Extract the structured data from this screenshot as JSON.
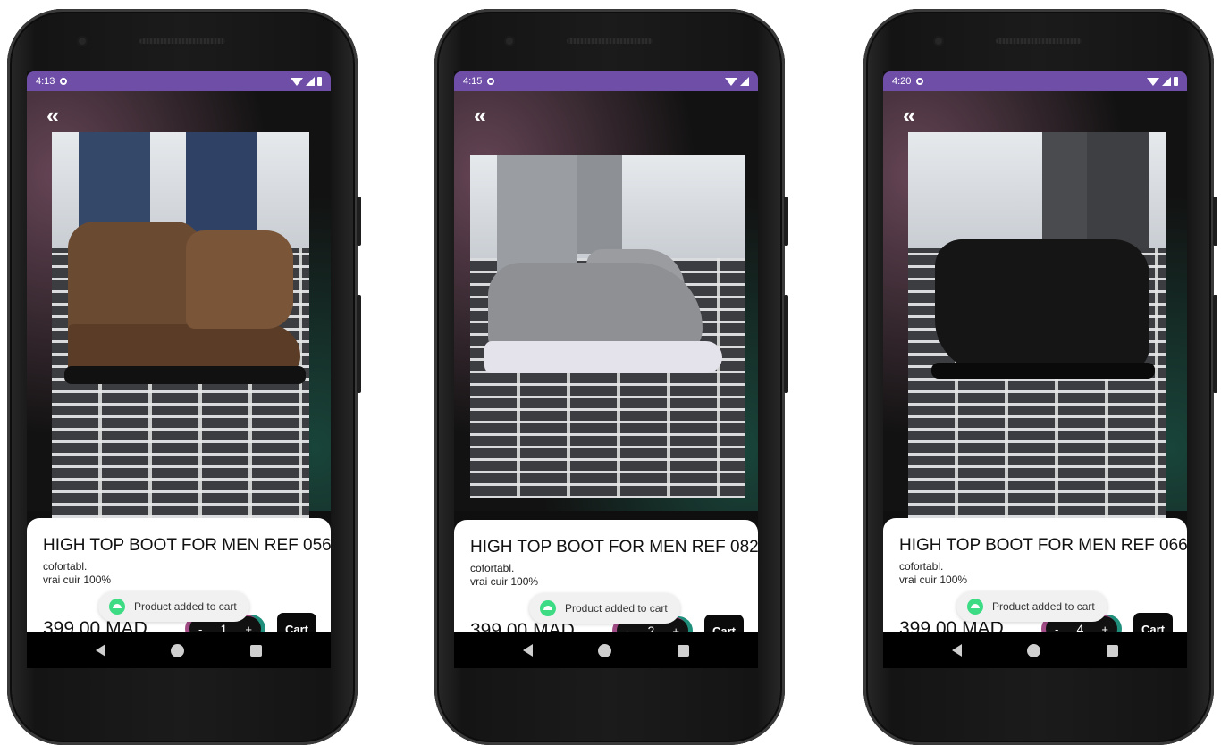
{
  "phones": [
    {
      "status_time": "4:13",
      "product_title": "HIGH TOP BOOT FOR MEN REF 056",
      "description_line1": "cofortabl.",
      "description_line2": "vrai cuir 100%",
      "price": "399.00 MAD",
      "quantity": "1",
      "minus_label": "-",
      "plus_label": "+",
      "cart_label": "Cart",
      "toast_text": "Product added to cart",
      "shoe_color": "#6b4a32",
      "shoe_style": "boot"
    },
    {
      "status_time": "4:15",
      "product_title": "HIGH TOP BOOT FOR MEN REF 082",
      "description_line1": "cofortabl.",
      "description_line2": "vrai cuir 100%",
      "price": "399.00 MAD",
      "quantity": "2",
      "minus_label": "-",
      "plus_label": "+",
      "cart_label": "Cart",
      "toast_text": "Product added to cart",
      "shoe_color": "#8e9093",
      "shoe_style": "sneaker"
    },
    {
      "status_time": "4:20",
      "product_title": "HIGH TOP BOOT FOR MEN REF 066",
      "description_line1": "cofortabl.",
      "description_line2": "vrai cuir 100%",
      "price": "399.00 MAD",
      "quantity": "4",
      "minus_label": "-",
      "plus_label": "+",
      "cart_label": "Cart",
      "toast_text": "Product added to cart",
      "shoe_color": "#151515",
      "shoe_style": "boot"
    }
  ],
  "back_icon": "double-chevron-left-icon",
  "accent_colors": {
    "status_bar": "#6f4ea8",
    "stepper_left": "#a24c86",
    "stepper_right": "#1f8f7b"
  }
}
